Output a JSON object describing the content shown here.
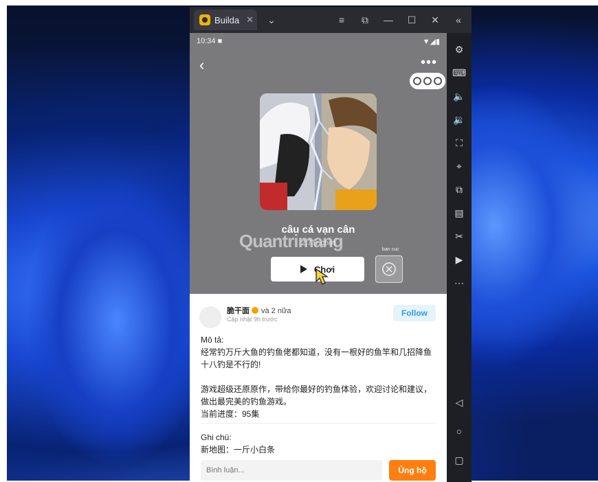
{
  "window": {
    "tab_label": "Builda",
    "tab_close": "✕",
    "tab_dropdown": "⌄",
    "controls": {
      "menu": "≡",
      "screenshot": "⧉",
      "minimize": "—",
      "maximize": "☐",
      "close": "✕",
      "collapse": "«"
    }
  },
  "status_bar": {
    "time": "10:34",
    "notif_icon": "■",
    "signal": "▼◢▮"
  },
  "game": {
    "name": "câu cá vạn cân",
    "plays": "2,7Tr chơi",
    "play_label": "Chơi",
    "favorite_label": "ban cuc"
  },
  "watermark": "Quantrimang",
  "post": {
    "author": "脆干面",
    "author_more": "và 2 nữa",
    "updated": "Cập nhật 9h trước",
    "follow_label": "Follow",
    "desc_label": "Mô tả:",
    "desc_line1": "经常钓万斤大鱼的钓鱼佬都知道，没有一根好的鱼竿和几招降鱼十八钓是不行的!",
    "desc_line2": "游戏超级还原原作，带给你最好的钓鱼体验，欢迎讨论和建议，做出最完美的钓鱼游戏。",
    "desc_line3": "当前进度：95集",
    "note_label": "Ghi chú:",
    "note_text": "新地图：一斤小白条",
    "comment_placeholder": "Bình luận...",
    "support_label": "Ủng hộ"
  },
  "colors": {
    "accent_orange": "#ff7e10",
    "follow_blue": "#2b9fe0",
    "hero_gray": "#7a7a7c"
  }
}
